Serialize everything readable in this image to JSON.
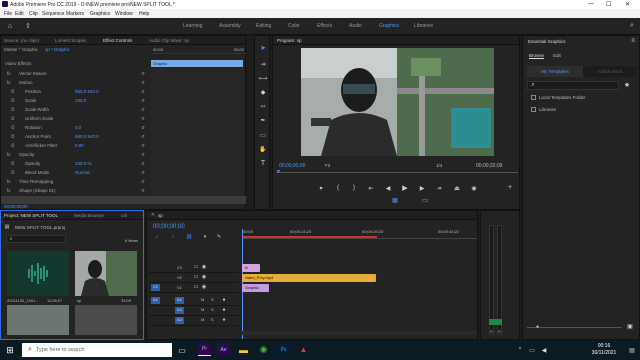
{
  "window": {
    "title": "Adobe Premiere Pro CC 2019 - D:\\NEW premiere pro\\NEW SPLIT TOOL *",
    "controls": [
      "—",
      "☐",
      "✕"
    ]
  },
  "menu": [
    "File",
    "Edit",
    "Clip",
    "Sequence",
    "Markers",
    "Graphics",
    "Window",
    "Help"
  ],
  "workspaces": [
    "Learning",
    "Assembly",
    "Editing",
    "Color",
    "Effects",
    "Audio",
    "Graphics",
    "Libraries"
  ],
  "workspace_active": "Graphics",
  "effect_controls": {
    "tabs": [
      "Source: (no clips)",
      "Lumetri Scopes",
      "Effect Controls",
      "Audio Clip Mixer: sp"
    ],
    "active_tab": "Effect Controls",
    "master_label": "Master * Graphic",
    "clip_label": "sp * Graphic",
    "section": "Video Effects",
    "rows": [
      {
        "label": "Vector Motion",
        "value": "",
        "indent": 1
      },
      {
        "label": "Motion",
        "value": "",
        "indent": 1
      },
      {
        "label": "Position",
        "value": "960.0   540.0",
        "indent": 2
      },
      {
        "label": "Scale",
        "value": "100.0",
        "indent": 2
      },
      {
        "label": "Scale Width",
        "value": "",
        "indent": 2
      },
      {
        "label": "Uniform Scale",
        "value": "",
        "indent": 2
      },
      {
        "label": "Rotation",
        "value": "0.0",
        "indent": 2
      },
      {
        "label": "Anchor Point",
        "value": "960.0   540.0",
        "indent": 2
      },
      {
        "label": "Anti-flicker Filter",
        "value": "0.00",
        "indent": 2
      },
      {
        "label": "Opacity",
        "value": "",
        "indent": 1
      },
      {
        "label": "Opacity",
        "value": "100.0 %",
        "indent": 2
      },
      {
        "label": "Blend Mode",
        "value": "Normal",
        "indent": 2
      },
      {
        "label": "Time Remapping",
        "value": "",
        "indent": 1
      },
      {
        "label": "Shape (Shape 01)",
        "value": "",
        "indent": 1
      }
    ],
    "graphic_bar": "Graphic",
    "timecode": "00;00;00;00",
    "ruler_left": "00;00",
    "ruler_right": "00;00"
  },
  "program": {
    "title": "Program: sp",
    "timecode_left": "00;00;00;00",
    "fit": "Fit",
    "quality": "1/4",
    "timecode_right": "00;00;33;09"
  },
  "essential_graphics": {
    "title": "Essential Graphics",
    "tabs": [
      "Browse",
      "Edit"
    ],
    "my_templates": "My Templates",
    "adobe_stock": "Adobe Stock",
    "checkboxes": [
      "Local Templates Folder",
      "Libraries"
    ]
  },
  "project": {
    "tabs": [
      "Project: NEW SPLIT TOOL",
      "Media Browser",
      "Lib"
    ],
    "file": "NEW SPLIT TOOL.prproj",
    "count": "6 Items",
    "items": [
      {
        "name": "20211130_1001...",
        "duration": "11;05;07"
      },
      {
        "name": "sp",
        "duration": "33;09"
      }
    ]
  },
  "timeline": {
    "tab": "sp",
    "timecode": "00;00;00;00",
    "ruler": [
      "00;00",
      "00;00;14;23",
      "00;00;29;23",
      "00;00;44;22"
    ],
    "video_tracks": [
      "V3",
      "V2",
      "V1"
    ],
    "audio_tracks": [
      "A1",
      "A2",
      "A3"
    ],
    "clips": [
      {
        "label": "fx",
        "track": "V3"
      },
      {
        "label": "video_Prxy.mp4",
        "track": "V2"
      },
      {
        "label": "Graphic",
        "track": "V1"
      }
    ]
  },
  "taskbar": {
    "search_placeholder": "Type here to search",
    "time": "00:16",
    "date": "30/11/2021"
  }
}
